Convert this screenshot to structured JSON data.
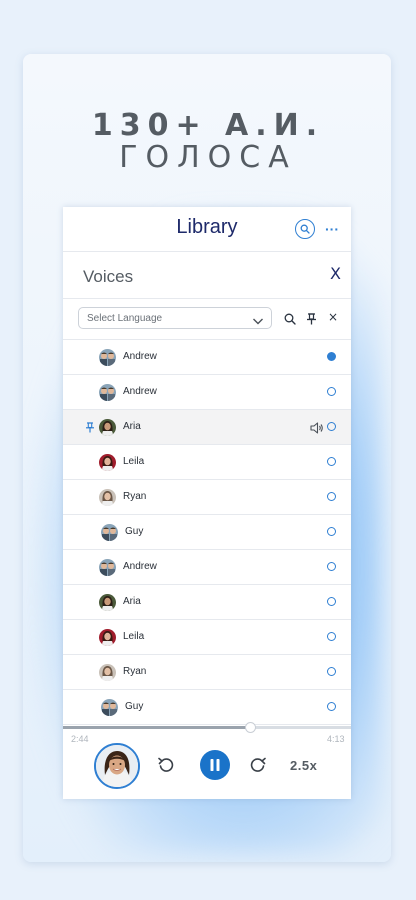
{
  "promo": {
    "line1": "130+ А.И.",
    "line2": "ГОЛОСА"
  },
  "library": {
    "title": "Library",
    "search_icon": "search-icon",
    "more_icon": "more-horizontal-icon",
    "more_label": "···"
  },
  "voices_panel": {
    "title": "Voices",
    "close_label": "X",
    "language_select": {
      "placeholder": "Select Language"
    },
    "filter_close_label": "×"
  },
  "voices": [
    {
      "name": "Andrew",
      "avatar": "avatar-andrew",
      "selected": true,
      "pinned": false,
      "playing": false
    },
    {
      "name": "Andrew",
      "avatar": "avatar-andrew",
      "selected": false,
      "pinned": false,
      "playing": false
    },
    {
      "name": "Aria",
      "avatar": "avatar-aria",
      "selected": false,
      "pinned": true,
      "playing": true
    },
    {
      "name": "Leila",
      "avatar": "avatar-leila",
      "selected": false,
      "pinned": false,
      "playing": false
    },
    {
      "name": "Ryan",
      "avatar": "avatar-ryan",
      "selected": false,
      "pinned": false,
      "playing": false
    },
    {
      "name": "Guy",
      "avatar": "avatar-guy",
      "selected": false,
      "pinned": false,
      "playing": false
    },
    {
      "name": "Andrew",
      "avatar": "avatar-andrew",
      "selected": false,
      "pinned": false,
      "playing": false
    },
    {
      "name": "Aria",
      "avatar": "avatar-aria",
      "selected": false,
      "pinned": false,
      "playing": false
    },
    {
      "name": "Leila",
      "avatar": "avatar-leila",
      "selected": false,
      "pinned": false,
      "playing": false
    },
    {
      "name": "Ryan",
      "avatar": "avatar-ryan",
      "selected": false,
      "pinned": false,
      "playing": false
    },
    {
      "name": "Guy",
      "avatar": "avatar-guy",
      "selected": false,
      "pinned": false,
      "playing": false
    }
  ],
  "player": {
    "elapsed": "2:44",
    "total": "4:13",
    "progress_fraction": 0.65,
    "speed": "2.5x",
    "state": "playing"
  },
  "colors": {
    "accent": "#2f7fd2",
    "play_button": "#1a73c9",
    "title": "#1e2a6a"
  }
}
